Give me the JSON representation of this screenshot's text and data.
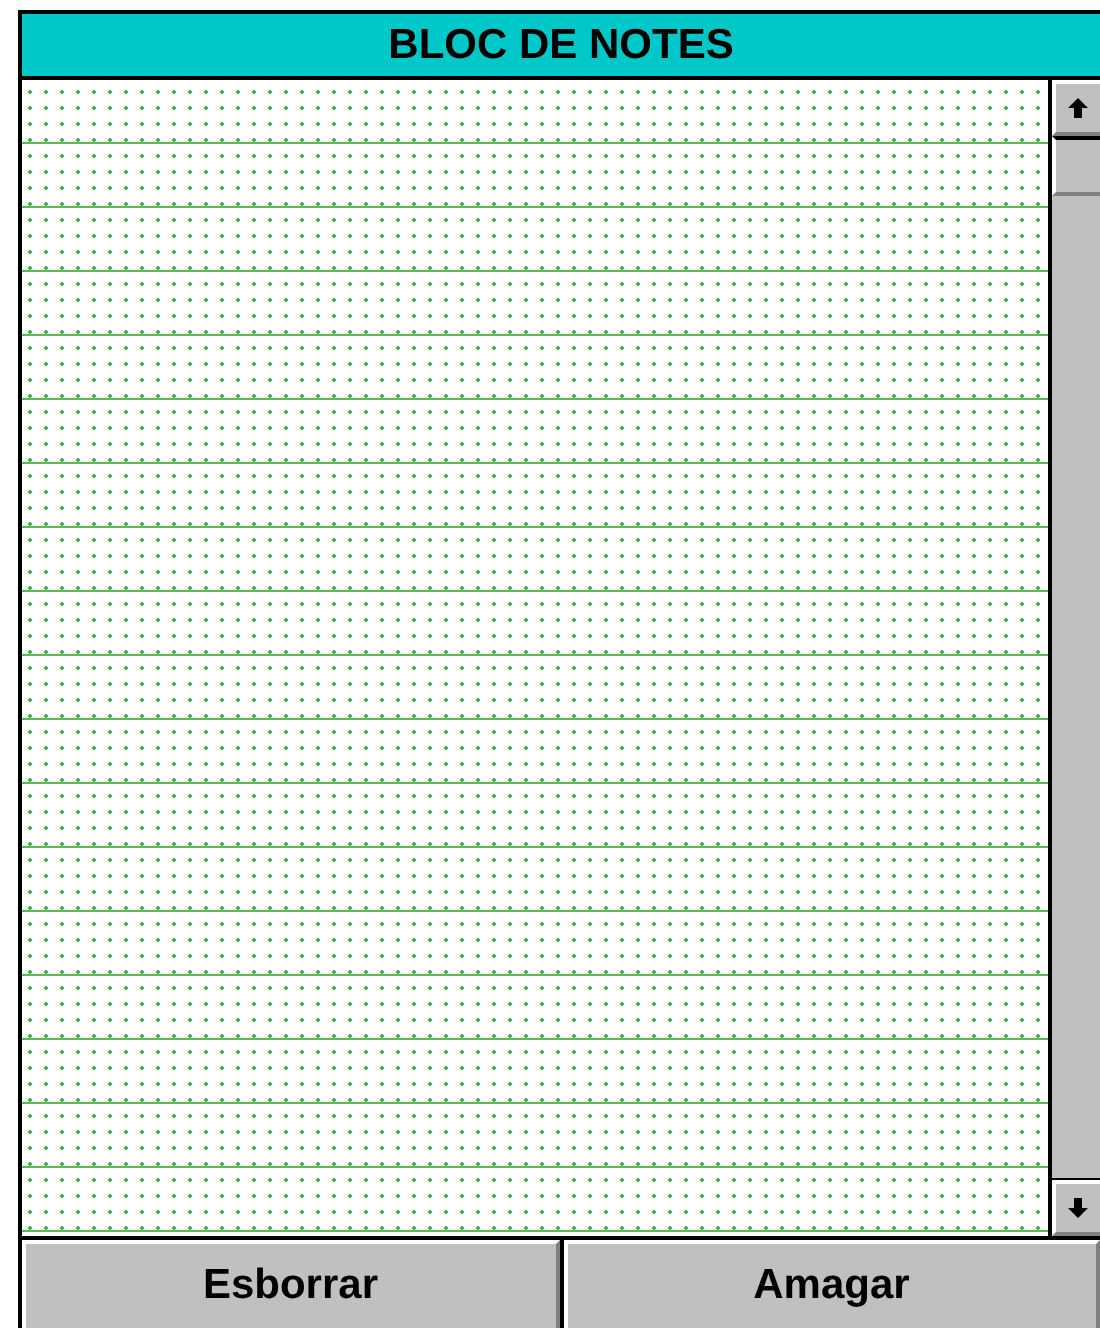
{
  "window": {
    "title": "BLOC DE NOTES"
  },
  "buttons": [
    {
      "label": "Esborrar"
    },
    {
      "label": "Amagar"
    }
  ]
}
